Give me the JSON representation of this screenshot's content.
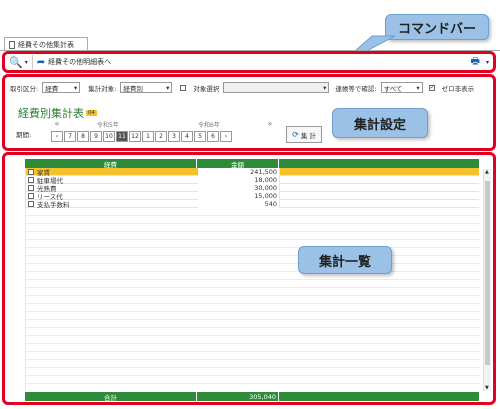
{
  "tab": {
    "label": "経費その他集計表"
  },
  "command_bar": {
    "nav_label": "経費その他明細表へ"
  },
  "callouts": {
    "command_bar": "コマンドバー",
    "settings": "集計設定",
    "list": "集計一覧"
  },
  "filters": {
    "label1": "取引区分:",
    "value1": "経費",
    "label2": "集計対象:",
    "value2": "経費別",
    "checkbox_label": "対象選択",
    "label3": "連帳等で確認:",
    "value3": "すべて",
    "zero_label": "ゼロ非表示"
  },
  "report": {
    "title": "経費別集計表",
    "badge": "04",
    "period_label": "期間:",
    "year_left": "令和5年",
    "year_right": "令和6年",
    "months": [
      "7",
      "8",
      "9",
      "10",
      "11",
      "12",
      "1",
      "2",
      "3",
      "4",
      "5",
      "6"
    ],
    "active_month": "11",
    "calc_label": "集 計"
  },
  "table": {
    "headers": [
      "経費",
      "金額"
    ],
    "rows": [
      {
        "name": "家賃",
        "amount": "241,500"
      },
      {
        "name": "駐車場代",
        "amount": "18,000"
      },
      {
        "name": "光熱費",
        "amount": "30,000"
      },
      {
        "name": "リース代",
        "amount": "15,000"
      },
      {
        "name": "支払手数料",
        "amount": "540"
      }
    ],
    "total_label": "合計",
    "total_value": "305,040"
  }
}
